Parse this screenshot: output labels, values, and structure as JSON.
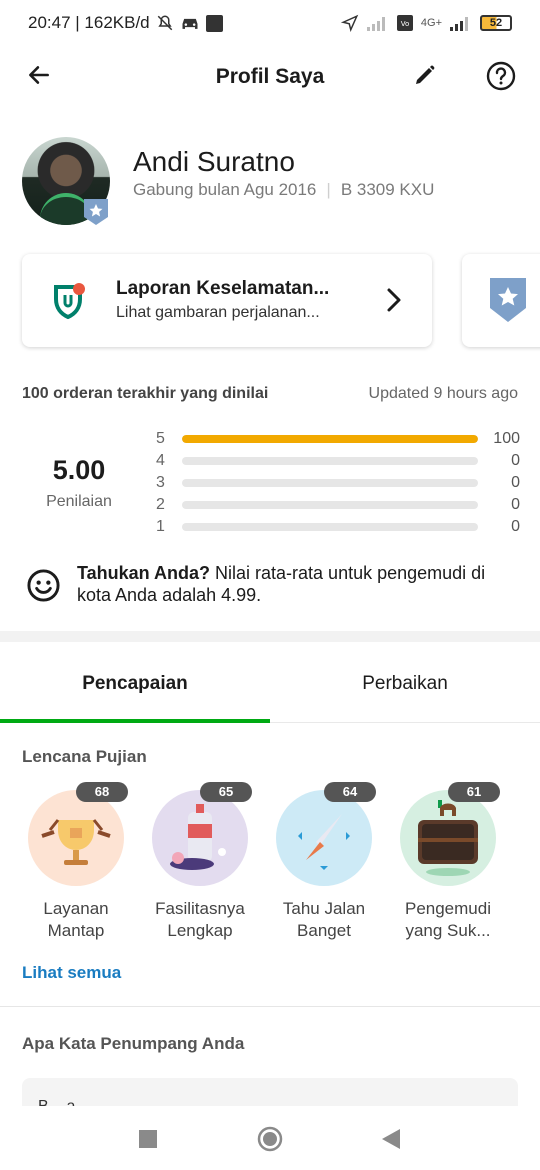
{
  "status_bar": {
    "time_speed": "20:47 | 162KB/d",
    "battery": "52",
    "network": "4G+"
  },
  "app_bar": {
    "title": "Profil Saya",
    "icons": [
      "back-arrow-icon",
      "edit-pencil-icon",
      "help-icon"
    ]
  },
  "profile": {
    "name": "Andi Suratno",
    "joined": "Gabung bulan Agu 2016",
    "plate": "B 3309 KXU"
  },
  "safety_card": {
    "title": "Laporan Keselamatan...",
    "subtitle": "Lihat gambaran perjalanan..."
  },
  "ratings": {
    "header_left": "100 orderan terakhir yang dinilai",
    "header_right": "Updated 9 hours ago",
    "score": "5.00",
    "score_label": "Penilaian",
    "breakdown": [
      {
        "star": "5",
        "count": "100",
        "fraction": 1.0
      },
      {
        "star": "4",
        "count": "0",
        "fraction": 0
      },
      {
        "star": "3",
        "count": "0",
        "fraction": 0
      },
      {
        "star": "2",
        "count": "0",
        "fraction": 0
      },
      {
        "star": "1",
        "count": "0",
        "fraction": 0
      }
    ],
    "bar_color": "#f2a900"
  },
  "tip": {
    "bold": "Tahukan Anda?",
    "text": " Nilai rata-rata untuk pengemudi di kota Anda adalah 4.99."
  },
  "tabs": {
    "active": "Pencapaian",
    "other": "Perbaikan",
    "accent": "#00aa13"
  },
  "compliments": {
    "title": "Lencana Pujian",
    "badges": [
      {
        "count": "68",
        "label": "Layanan Mantap",
        "bg": "#fde3d3"
      },
      {
        "count": "65",
        "label": "Fasilitasnya Lengkap",
        "bg": "#e3dcef"
      },
      {
        "count": "64",
        "label": "Tahu Jalan Banget",
        "bg": "#cdeaf6"
      },
      {
        "count": "61",
        "label": "Pengemudi yang Suk...",
        "bg": "#d6efe1"
      }
    ],
    "see_all": "Lihat semua"
  },
  "passenger": {
    "title": "Apa Kata Penumpang Anda",
    "comment_preview": "B... a... ... ... ..."
  }
}
